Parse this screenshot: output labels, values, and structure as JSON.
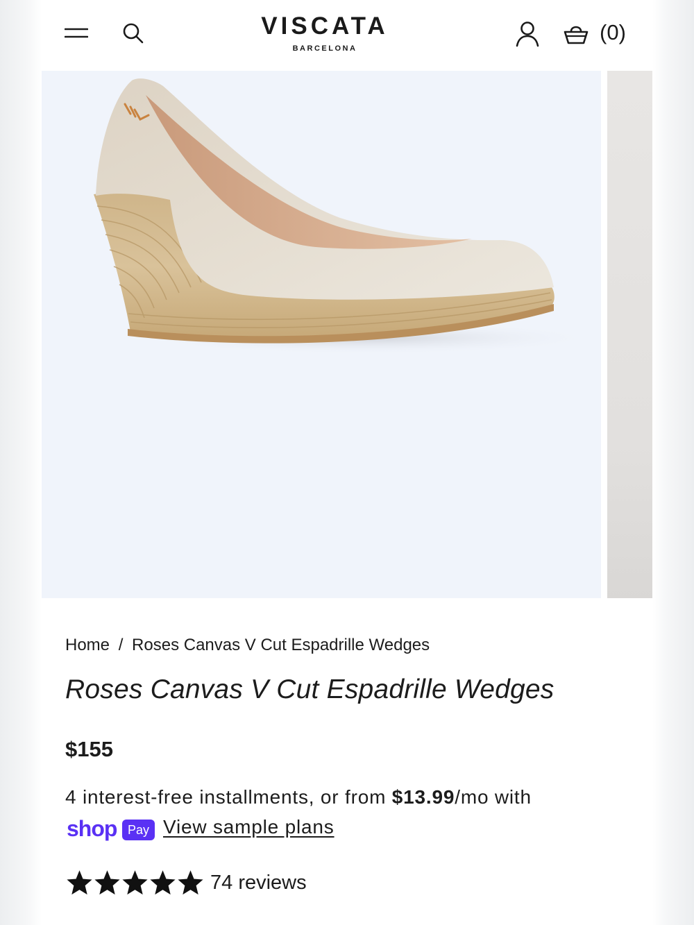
{
  "header": {
    "brand_name": "VISCATA",
    "brand_location": "BARCELONA",
    "cart_count": "(0)",
    "icons": [
      "menu-icon",
      "search-icon",
      "account-icon",
      "cart-icon"
    ]
  },
  "gallery": {
    "images": [
      "product-image-main",
      "product-image-next"
    ]
  },
  "breadcrumb": {
    "home": "Home",
    "separator": "/",
    "current": "Roses Canvas V Cut Espadrille Wedges"
  },
  "product": {
    "title": "Roses Canvas V Cut Espadrille Wedges",
    "price": "$155"
  },
  "installments": {
    "text_before": "4 interest-free installments, or from ",
    "amount": "$13.99",
    "text_after": "/mo with",
    "shop_logo": "shop",
    "pay_badge": "Pay",
    "view_plans": "View sample plans"
  },
  "rating": {
    "stars": 5,
    "max_stars": 5,
    "reviews": "74 reviews"
  },
  "colors": {
    "shop_pay_purple": "#5a31f4",
    "image_background": "#f0f4fb",
    "text": "#1c1c1c"
  }
}
